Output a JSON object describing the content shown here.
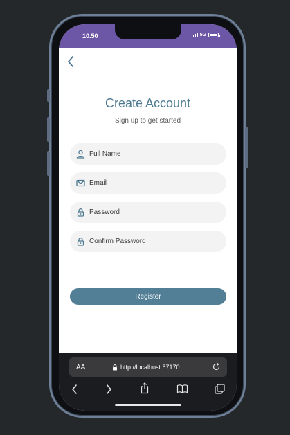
{
  "status": {
    "time": "10.50",
    "network": "5G"
  },
  "page": {
    "title": "Create Account",
    "subtitle": "Sign up to get started"
  },
  "form": {
    "full_name_placeholder": "Full Name",
    "email_placeholder": "Email",
    "password_placeholder": "Password",
    "confirm_password_placeholder": "Confirm Password",
    "register_label": "Register"
  },
  "browser": {
    "text_size_label": "AA",
    "url": "http://localhost:57170"
  },
  "icons": {
    "back": "chevron-left-icon",
    "full_name": "user-icon",
    "email": "mail-icon",
    "password": "lock-icon",
    "confirm_password": "lock-icon",
    "url_lock": "lock-icon",
    "reload": "reload-icon",
    "nav_back": "chevron-left-icon",
    "nav_forward": "chevron-right-icon",
    "share": "share-icon",
    "bookmarks": "book-icon",
    "tabs": "tabs-icon"
  },
  "colors": {
    "accent": "#527e96",
    "title": "#4e7a92",
    "status_bar": "#6c57a6",
    "field_bg": "#f3f3f3",
    "page_bg": "#24282b"
  }
}
